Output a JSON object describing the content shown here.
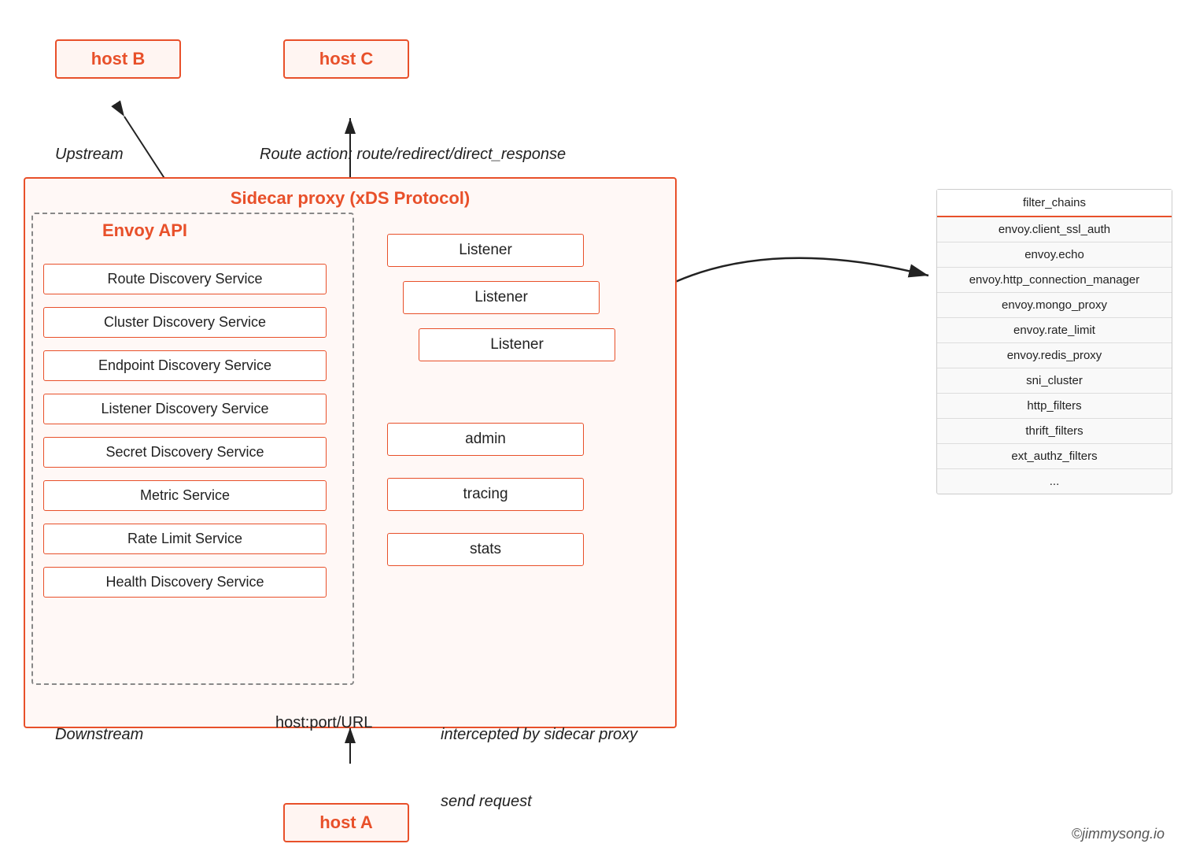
{
  "hosts": {
    "host_b": "host B",
    "host_c": "host C",
    "host_a": "host A"
  },
  "labels": {
    "upstream": "Upstream",
    "route_action": "Route action: route/redirect/direct_response",
    "downstream": "Downstream",
    "host_port": "host:port/URL",
    "intercepted": "intercepted by sidecar proxy",
    "send_request": "send request",
    "copyright": "©jimmysong.io"
  },
  "sidecar": {
    "title": "Sidecar proxy (xDS Protocol)"
  },
  "envoy_api": {
    "title": "Envoy API",
    "services": [
      "Route Discovery Service",
      "Cluster Discovery Service",
      "Endpoint Discovery Service",
      "Listener Discovery Service",
      "Secret Discovery Service",
      "Metric Service",
      "Rate Limit Service",
      "Health Discovery Service"
    ]
  },
  "listeners": [
    "Listener",
    "Listener",
    "Listener"
  ],
  "other_items": [
    "admin",
    "tracing",
    "stats"
  ],
  "filter_chains": {
    "header": "filter_chains",
    "items": [
      "envoy.client_ssl_auth",
      "envoy.echo",
      "envoy.http_connection_manager",
      "envoy.mongo_proxy",
      "envoy.rate_limit",
      "envoy.redis_proxy",
      "sni_cluster",
      "http_filters",
      "thrift_filters",
      "ext_authz_filters",
      "..."
    ]
  },
  "colors": {
    "orange": "#e8502a",
    "light_orange_bg": "#fff5f2",
    "dashed_border": "#888"
  }
}
